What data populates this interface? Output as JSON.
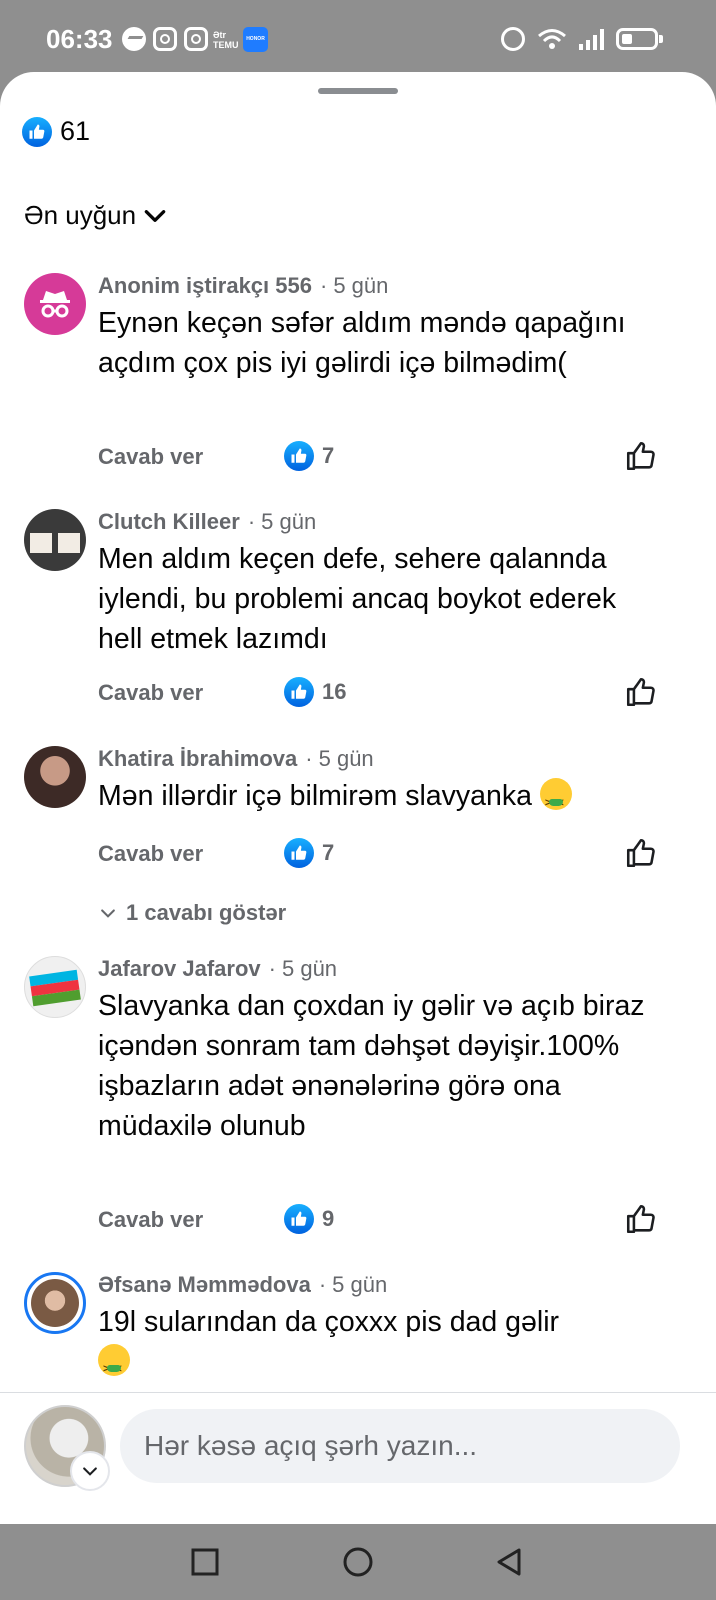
{
  "status_bar": {
    "time": "06:33",
    "temu_label": "Ətr\nTEMU",
    "honor_label": "HONOR"
  },
  "reactions": {
    "count": "61",
    "icon": "thumbs-up-icon",
    "color": "#1877f2"
  },
  "sort": {
    "label": "Ən uyğun"
  },
  "comments": [
    {
      "author": "Anonim iştirakçı 556",
      "time": "5 gün",
      "text": "Eynən keçən səfər aldım məndə qapağını açdım çox pis iyi gəlirdi içə bilmədim(",
      "reply_label": "Cavab ver",
      "likes": "7"
    },
    {
      "author": "Clutch Killeer",
      "time": "5 gün",
      "text": "Men aldım keçen defe, sehere qalannda iylendi, bu problemi ancaq boykot ederek hell etmek lazımdı",
      "reply_label": "Cavab ver",
      "likes": "16"
    },
    {
      "author": "Khatira İbrahimova",
      "time": "5 gün",
      "text": "Mən illərdir içə bilmirəm slavyanka",
      "reply_label": "Cavab ver",
      "likes": "7",
      "replies_label": "1 cavabı göstər"
    },
    {
      "author": "Jafarov Jafarov",
      "time": "5 gün",
      "text": "Slavyanka dan çoxdan iy gəlir və açıb biraz içəndən sonram tam dəhşət dəyişir.100% işbazların adət ənənələrinə görə ona müdaxilə olunub",
      "reply_label": "Cavab ver",
      "likes": "9"
    },
    {
      "author": "Əfsanə Məmmədova",
      "time": "5 gün",
      "text": "19l sularından da çoxxx pis dad gəlir"
    }
  ],
  "composer": {
    "placeholder": "Hər kəsə açıq şərh yazın..."
  }
}
